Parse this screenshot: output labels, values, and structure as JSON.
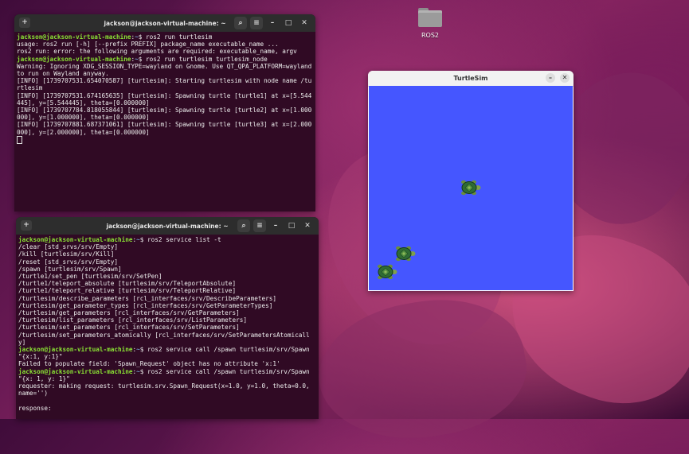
{
  "desktop": {
    "folder_label": "ROS2"
  },
  "terminal1": {
    "title": "jackson@jackson-virtual-machine: ~",
    "lines": [
      {
        "user": "jackson@jackson-virtual-machine",
        "sep": ":",
        "path": "~",
        "cmd": "$ ros2 run turtlesim"
      },
      {
        "text": "usage: ros2 run [-h] [--prefix PREFIX] package_name executable_name ..."
      },
      {
        "text": "ros2 run: error: the following arguments are required: executable_name, argv"
      },
      {
        "user": "jackson@jackson-virtual-machine",
        "sep": ":",
        "path": "~",
        "cmd": "$ ros2 run turtlesim turtlesim_node"
      },
      {
        "text": "Warning: Ignoring XDG_SESSION_TYPE=wayland on Gnome. Use QT_QPA_PLATFORM=wayland to run on Wayland anyway."
      },
      {
        "text": "[INFO] [1739707531.654070587] [turtlesim]: Starting turtlesim with node name /turtlesim"
      },
      {
        "text": "[INFO] [1739707531.674165635] [turtlesim]: Spawning turtle [turtle1] at x=[5.544445], y=[5.544445], theta=[0.000000]"
      },
      {
        "text": "[INFO] [1739707784.818055844] [turtlesim]: Spawning turtle [turtle2] at x=[1.000000], y=[1.000000], theta=[0.000000]"
      },
      {
        "text": "[INFO] [1739707881.687371061] [turtlesim]: Spawning turtle [turtle3] at x=[2.000000], y=[2.000000], theta=[0.000000]"
      }
    ]
  },
  "terminal2": {
    "title": "jackson@jackson-virtual-machine: ~",
    "lines": [
      {
        "user": "jackson@jackson-virtual-machine",
        "sep": ":",
        "path": "~",
        "cmd": "$ ros2 service list -t"
      },
      {
        "text": "/clear [std_srvs/srv/Empty]"
      },
      {
        "text": "/kill [turtlesim/srv/Kill]"
      },
      {
        "text": "/reset [std_srvs/srv/Empty]"
      },
      {
        "text": "/spawn [turtlesim/srv/Spawn]"
      },
      {
        "text": "/turtle1/set_pen [turtlesim/srv/SetPen]"
      },
      {
        "text": "/turtle1/teleport_absolute [turtlesim/srv/TeleportAbsolute]"
      },
      {
        "text": "/turtle1/teleport_relative [turtlesim/srv/TeleportRelative]"
      },
      {
        "text": "/turtlesim/describe_parameters [rcl_interfaces/srv/DescribeParameters]"
      },
      {
        "text": "/turtlesim/get_parameter_types [rcl_interfaces/srv/GetParameterTypes]"
      },
      {
        "text": "/turtlesim/get_parameters [rcl_interfaces/srv/GetParameters]"
      },
      {
        "text": "/turtlesim/list_parameters [rcl_interfaces/srv/ListParameters]"
      },
      {
        "text": "/turtlesim/set_parameters [rcl_interfaces/srv/SetParameters]"
      },
      {
        "text": "/turtlesim/set_parameters_atomically [rcl_interfaces/srv/SetParametersAtomically]"
      },
      {
        "user": "jackson@jackson-virtual-machine",
        "sep": ":",
        "path": "~",
        "cmd": "$ ros2 service call /spawn turtlesim/srv/Spawn \"{x:1, y:1}\""
      },
      {
        "text": "Failed to populate field: 'Spawn_Request' object has no attribute 'x:1'"
      },
      {
        "user": "jackson@jackson-virtual-machine",
        "sep": ":",
        "path": "~",
        "cmd": "$ ros2 service call /spawn turtlesim/srv/Spawn \"{x: 1, y: 1}\""
      },
      {
        "text": "requester: making request: turtlesim.srv.Spawn_Request(x=1.0, y=1.0, theta=0.0, name='')"
      },
      {
        "text": " "
      },
      {
        "text": "response:"
      }
    ]
  },
  "turtlesim": {
    "title": "TurtleSim",
    "background_color": "#4556ff",
    "turtles": [
      {
        "name": "turtle1",
        "x": 5.544445,
        "y": 5.544445,
        "theta": 0.0
      },
      {
        "name": "turtle2",
        "x": 1.0,
        "y": 1.0,
        "theta": 0.0
      },
      {
        "name": "turtle3",
        "x": 2.0,
        "y": 2.0,
        "theta": 0.0
      }
    ]
  },
  "icons": {
    "new_tab": "new-tab-icon",
    "search": "search-icon",
    "menu": "hamburger-menu-icon",
    "minimize": "minimize-icon",
    "maximize": "maximize-icon",
    "close": "close-icon"
  },
  "colors": {
    "terminal_bg": "#300a24",
    "prompt_user": "#8ae234",
    "prompt_path": "#729fcf"
  }
}
